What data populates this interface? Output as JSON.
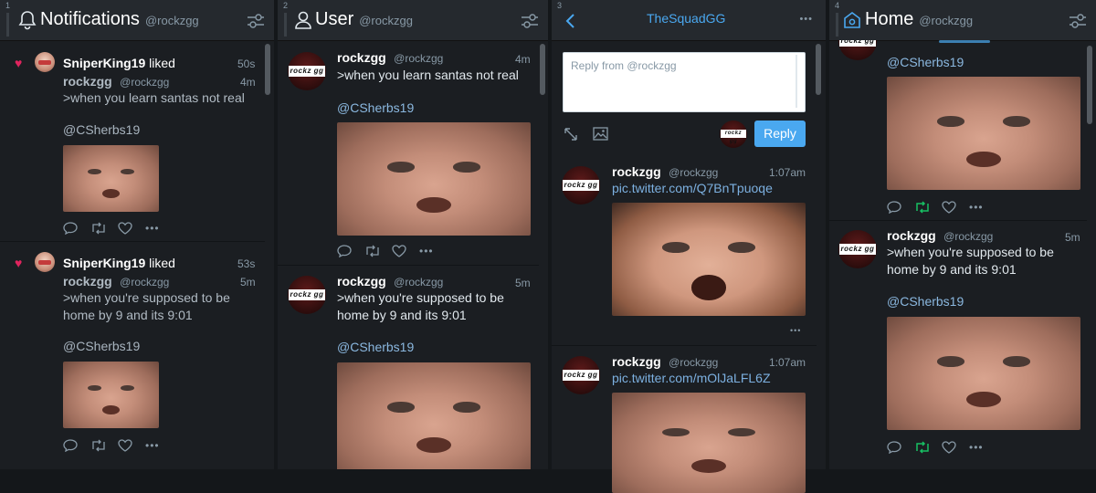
{
  "columns": [
    {
      "number": "1",
      "title": "Notifications",
      "account": "@rockzgg",
      "icon": "bell-icon",
      "items": [
        {
          "liker": "SniperKing19",
          "liked_label": "liked",
          "like_time": "50s",
          "author": "rockzgg",
          "handle": "@rockzgg",
          "time": "4m",
          "text": ">when you learn santas not real",
          "mention": "@CSherbs19"
        },
        {
          "liker": "SniperKing19",
          "liked_label": "liked",
          "like_time": "53s",
          "author": "rockzgg",
          "handle": "@rockzgg",
          "time": "5m",
          "text_line1": ">when you're supposed to be",
          "text_line2": "home by 9 and its 9:01",
          "mention": "@CSherbs19"
        }
      ]
    },
    {
      "number": "2",
      "title": "User",
      "account": "@rockzgg",
      "icon": "user-icon",
      "items": [
        {
          "author": "rockzgg",
          "handle": "@rockzgg",
          "time": "4m",
          "text": ">when you learn santas not real",
          "mention": "@CSherbs19"
        },
        {
          "author": "rockzgg",
          "handle": "@rockzgg",
          "time": "5m",
          "text_line1": ">when you're supposed to be",
          "text_line2": "home by 9 and its 9:01",
          "mention": "@CSherbs19"
        }
      ]
    },
    {
      "number": "3",
      "title": "TheSquadGG",
      "reply_placeholder": "Reply from @rockzgg",
      "reply_button": "Reply",
      "items": [
        {
          "author": "rockzgg",
          "handle": "@rockzgg",
          "time": "1:07am",
          "link": "pic.twitter.com/Q7BnTpuoqe"
        },
        {
          "author": "rockzgg",
          "handle": "@rockzgg",
          "time": "1:07am",
          "link": "pic.twitter.com/mOlJaLFL6Z"
        }
      ]
    },
    {
      "number": "4",
      "title": "Home",
      "account": "@rockzgg",
      "icon": "home-icon",
      "items": [
        {
          "mention": "@CSherbs19"
        },
        {
          "author": "rockzgg",
          "handle": "@rockzgg",
          "time": "5m",
          "text_line1": ">when you're supposed to be",
          "text_line2": "home by 9 and its 9:01",
          "mention": "@CSherbs19"
        }
      ]
    }
  ],
  "avatar_logo": "rockz gg",
  "colors": {
    "accent": "#4aa8f0",
    "retweet_active": "#17bf63",
    "like": "#e0245e",
    "link": "#7cb0e0"
  }
}
